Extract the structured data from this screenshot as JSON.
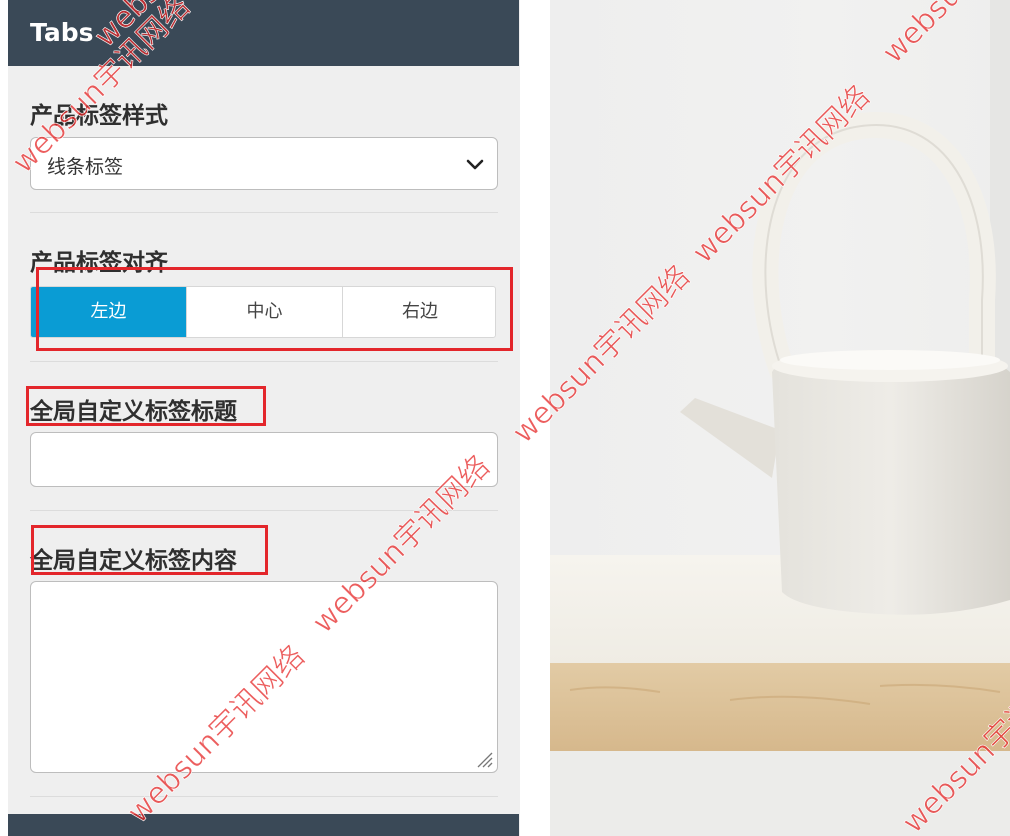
{
  "panel": {
    "title": "Tabs",
    "style_label": "产品标签样式",
    "style_select": {
      "value": "线条标签"
    },
    "align_label": "产品标签对齐",
    "align_options": [
      "左边",
      "中心",
      "右边"
    ],
    "align_selected": "左边",
    "title_label": "全局自定义标签标题",
    "title_input": {
      "value": ""
    },
    "content_label": "全局自定义标签内容",
    "content_textarea": {
      "value": ""
    }
  },
  "watermark_text": "websun宇讯网络",
  "colors": {
    "header_bg": "#3a4957",
    "panel_bg": "#efefef",
    "accent": "#0a9cd4",
    "highlight": "#e3262b",
    "watermark": "#e62828"
  },
  "icons": {
    "select_arrow": "chevron-down-icon",
    "textarea_resize": "resize-handle-icon"
  }
}
